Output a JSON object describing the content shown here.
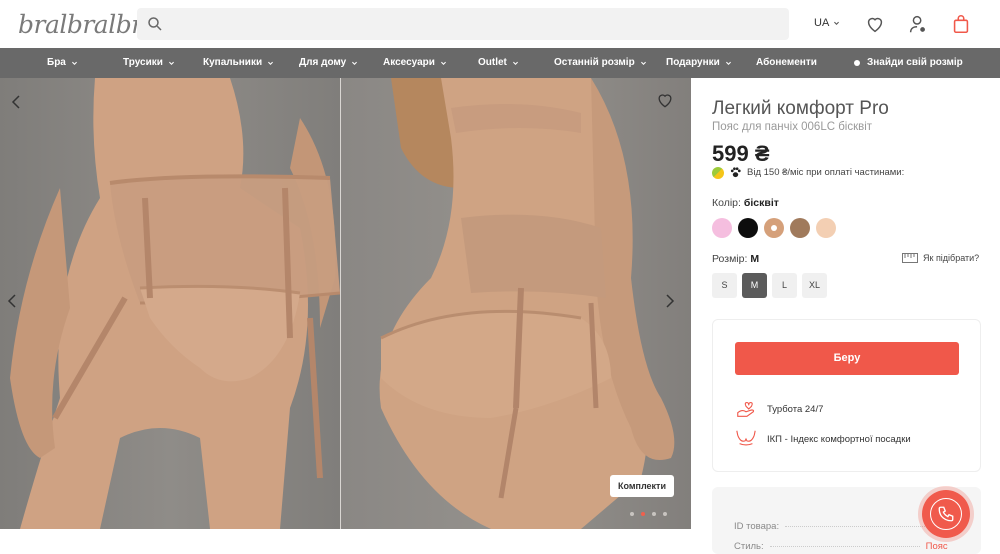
{
  "header": {
    "logo": "bralbralbra",
    "search_placeholder": "",
    "lang": "UA"
  },
  "nav": {
    "items": [
      {
        "label": "Бра",
        "dropdown": true
      },
      {
        "label": "Трусики",
        "dropdown": true
      },
      {
        "label": "Купальники",
        "dropdown": true
      },
      {
        "label": "Для дому",
        "dropdown": true
      },
      {
        "label": "Аксесуари",
        "dropdown": true
      },
      {
        "label": "Outlet",
        "dropdown": true
      },
      {
        "label": "Останній розмір",
        "dropdown": true
      },
      {
        "label": "Подарунки",
        "dropdown": true
      },
      {
        "label": "Абонементи",
        "dropdown": false
      }
    ],
    "find_size": "Знайди свій розмір"
  },
  "gallery": {
    "kit_label": "Комплекти",
    "dots": 4,
    "active_dot": 2
  },
  "product": {
    "title": "Легкий комфорт Pro",
    "subtitle": "Пояс для панчіх 006LC бісквіт",
    "price": "599 ₴",
    "installment": "Від 150 ₴/міс при оплаті частинами:",
    "color_label": "Колір:",
    "color_value": "бісквіт",
    "swatches": [
      {
        "color": "#f5bedf",
        "selected": false
      },
      {
        "color": "#0d0d0d",
        "selected": false
      },
      {
        "color": "#d5a07a",
        "selected": true
      },
      {
        "color": "#a07a5c",
        "selected": false
      },
      {
        "color": "#f3cfb3",
        "selected": false
      }
    ],
    "size_label": "Розмір:",
    "size_value": "M",
    "size_guide": "Як підібрати?",
    "sizes": [
      {
        "label": "S",
        "active": false
      },
      {
        "label": "M",
        "active": true
      },
      {
        "label": "L",
        "active": false
      },
      {
        "label": "XL",
        "active": false
      }
    ]
  },
  "buy": {
    "button": "Беру",
    "features": [
      {
        "icon": "care-hands-icon",
        "label": "Турбота 24/7"
      },
      {
        "icon": "bra-icon",
        "label": "ІКП - Індекс комфортної посадки"
      }
    ]
  },
  "info": {
    "id_label": "ID товара:",
    "style_label": "Стиль:",
    "style_value": "Пояс"
  },
  "colors": {
    "accent": "#f0584a",
    "nav_bg": "#696969"
  }
}
